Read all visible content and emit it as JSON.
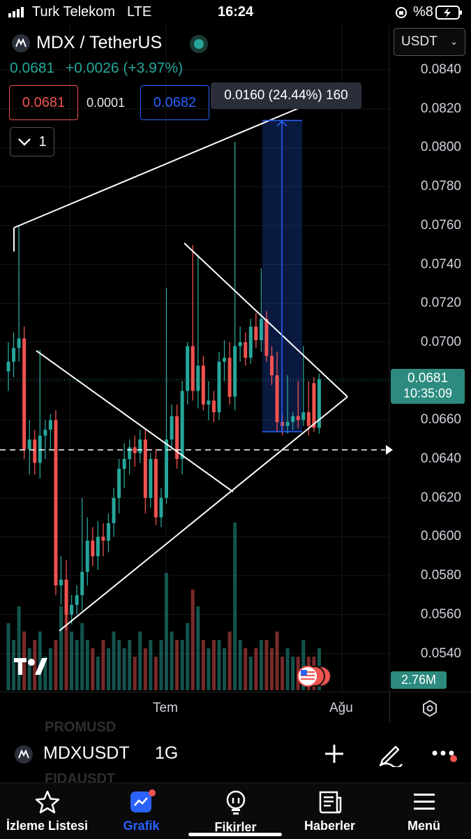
{
  "status_bar": {
    "carrier": "Turk Telekom",
    "network": "LTE",
    "time": "16:24",
    "battery": "%8"
  },
  "header": {
    "symbol_title": "MDX / TetherUS",
    "quote_currency": "USDT",
    "last_price": "0.0681",
    "change": "+0.0026 (+3.97%)",
    "sell_price": "0.0681",
    "spread": "0.0001",
    "buy_price": "0.0682",
    "indicator_count": "1"
  },
  "measure_label": "0.0160 (24.44%) 160",
  "price_axis": [
    "0.0840",
    "0.0820",
    "0.0800",
    "0.0780",
    "0.0760",
    "0.0740",
    "0.0720",
    "0.0700",
    "0.0660",
    "0.0640",
    "0.0620",
    "0.0600",
    "0.0580",
    "0.0560",
    "0.0540"
  ],
  "current_price_tag": {
    "price": "0.0681",
    "countdown": "10:35:09"
  },
  "volume_tag": "2.76M",
  "time_axis": [
    "Tem",
    "Ağu"
  ],
  "symbol_bar": {
    "ticker": "MDXUSDT",
    "interval": "1G",
    "ghost_above": "PROMUSD",
    "ghost_below": "FIDAUSDT"
  },
  "tabs": [
    {
      "label": "İzleme Listesi",
      "icon": "star-icon"
    },
    {
      "label": "Grafik",
      "icon": "chart-icon"
    },
    {
      "label": "Fikirler",
      "icon": "lightbulb-icon"
    },
    {
      "label": "Haberler",
      "icon": "news-icon"
    },
    {
      "label": "Menü",
      "icon": "menu-icon"
    }
  ],
  "colors": {
    "up": "#26a69a",
    "down": "#ef5350",
    "accent": "#2962ff",
    "background": "#000000"
  },
  "chart_data": {
    "type": "candlestick",
    "title": "MDX / TetherUS",
    "ylim": [
      0.0525,
      0.0848
    ],
    "candles": [
      {
        "o": 0.0685,
        "h": 0.07,
        "l": 0.0675,
        "c": 0.069
      },
      {
        "o": 0.069,
        "h": 0.0705,
        "l": 0.0682,
        "c": 0.0697
      },
      {
        "o": 0.0697,
        "h": 0.076,
        "l": 0.069,
        "c": 0.0702
      },
      {
        "o": 0.0702,
        "h": 0.0708,
        "l": 0.064,
        "c": 0.0645
      },
      {
        "o": 0.0645,
        "h": 0.066,
        "l": 0.0632,
        "c": 0.065
      },
      {
        "o": 0.065,
        "h": 0.0655,
        "l": 0.0632,
        "c": 0.0638
      },
      {
        "o": 0.0638,
        "h": 0.0696,
        "l": 0.063,
        "c": 0.0652
      },
      {
        "o": 0.0652,
        "h": 0.066,
        "l": 0.064,
        "c": 0.0655
      },
      {
        "o": 0.0655,
        "h": 0.0663,
        "l": 0.0645,
        "c": 0.066
      },
      {
        "o": 0.066,
        "h": 0.0665,
        "l": 0.057,
        "c": 0.0575
      },
      {
        "o": 0.0575,
        "h": 0.059,
        "l": 0.0565,
        "c": 0.0578
      },
      {
        "o": 0.0578,
        "h": 0.0588,
        "l": 0.0552,
        "c": 0.056
      },
      {
        "o": 0.056,
        "h": 0.057,
        "l": 0.0555,
        "c": 0.0565
      },
      {
        "o": 0.0565,
        "h": 0.0575,
        "l": 0.056,
        "c": 0.057
      },
      {
        "o": 0.057,
        "h": 0.062,
        "l": 0.0562,
        "c": 0.0582
      },
      {
        "o": 0.0582,
        "h": 0.061,
        "l": 0.0575,
        "c": 0.0598
      },
      {
        "o": 0.0598,
        "h": 0.0605,
        "l": 0.0585,
        "c": 0.059
      },
      {
        "o": 0.059,
        "h": 0.0608,
        "l": 0.0583,
        "c": 0.06
      },
      {
        "o": 0.06,
        "h": 0.0607,
        "l": 0.059,
        "c": 0.0598
      },
      {
        "o": 0.0598,
        "h": 0.0612,
        "l": 0.0592,
        "c": 0.0607
      },
      {
        "o": 0.0607,
        "h": 0.0625,
        "l": 0.06,
        "c": 0.062
      },
      {
        "o": 0.062,
        "h": 0.064,
        "l": 0.0612,
        "c": 0.0635
      },
      {
        "o": 0.0635,
        "h": 0.0648,
        "l": 0.0625,
        "c": 0.064
      },
      {
        "o": 0.064,
        "h": 0.065,
        "l": 0.0632,
        "c": 0.0646
      },
      {
        "o": 0.0646,
        "h": 0.0652,
        "l": 0.0636,
        "c": 0.0643
      },
      {
        "o": 0.0643,
        "h": 0.0655,
        "l": 0.0638,
        "c": 0.065
      },
      {
        "o": 0.065,
        "h": 0.0655,
        "l": 0.0612,
        "c": 0.062
      },
      {
        "o": 0.062,
        "h": 0.0643,
        "l": 0.0615,
        "c": 0.064
      },
      {
        "o": 0.064,
        "h": 0.0645,
        "l": 0.0606,
        "c": 0.061
      },
      {
        "o": 0.061,
        "h": 0.0625,
        "l": 0.0605,
        "c": 0.062
      },
      {
        "o": 0.062,
        "h": 0.0728,
        "l": 0.0617,
        "c": 0.065
      },
      {
        "o": 0.065,
        "h": 0.0668,
        "l": 0.0645,
        "c": 0.0662
      },
      {
        "o": 0.0662,
        "h": 0.0668,
        "l": 0.0635,
        "c": 0.064
      },
      {
        "o": 0.064,
        "h": 0.068,
        "l": 0.0632,
        "c": 0.0675
      },
      {
        "o": 0.0675,
        "h": 0.07,
        "l": 0.0668,
        "c": 0.0698
      },
      {
        "o": 0.0698,
        "h": 0.075,
        "l": 0.067,
        "c": 0.0675
      },
      {
        "o": 0.0675,
        "h": 0.0745,
        "l": 0.0666,
        "c": 0.0688
      },
      {
        "o": 0.0688,
        "h": 0.0693,
        "l": 0.0665,
        "c": 0.0668
      },
      {
        "o": 0.0668,
        "h": 0.068,
        "l": 0.066,
        "c": 0.067
      },
      {
        "o": 0.067,
        "h": 0.0675,
        "l": 0.0659,
        "c": 0.0664
      },
      {
        "o": 0.0664,
        "h": 0.0695,
        "l": 0.066,
        "c": 0.069
      },
      {
        "o": 0.069,
        "h": 0.0701,
        "l": 0.068,
        "c": 0.0692
      },
      {
        "o": 0.0692,
        "h": 0.07,
        "l": 0.0668,
        "c": 0.0672
      },
      {
        "o": 0.0672,
        "h": 0.0803,
        "l": 0.0665,
        "c": 0.0698
      },
      {
        "o": 0.0698,
        "h": 0.0708,
        "l": 0.069,
        "c": 0.07
      },
      {
        "o": 0.07,
        "h": 0.0705,
        "l": 0.0688,
        "c": 0.0692
      },
      {
        "o": 0.0692,
        "h": 0.0712,
        "l": 0.0689,
        "c": 0.0708
      },
      {
        "o": 0.0708,
        "h": 0.0715,
        "l": 0.0697,
        "c": 0.0701
      },
      {
        "o": 0.0701,
        "h": 0.0738,
        "l": 0.0695,
        "c": 0.0712
      },
      {
        "o": 0.0712,
        "h": 0.0716,
        "l": 0.069,
        "c": 0.0693
      },
      {
        "o": 0.0693,
        "h": 0.0698,
        "l": 0.0678,
        "c": 0.0683
      },
      {
        "o": 0.0683,
        "h": 0.0695,
        "l": 0.0654,
        "c": 0.0659
      },
      {
        "o": 0.0659,
        "h": 0.0663,
        "l": 0.0652,
        "c": 0.0657
      },
      {
        "o": 0.0657,
        "h": 0.0683,
        "l": 0.0653,
        "c": 0.0659
      },
      {
        "o": 0.0659,
        "h": 0.0664,
        "l": 0.0655,
        "c": 0.0662
      },
      {
        "o": 0.0662,
        "h": 0.068,
        "l": 0.0656,
        "c": 0.066
      },
      {
        "o": 0.066,
        "h": 0.0698,
        "l": 0.0657,
        "c": 0.0664
      },
      {
        "o": 0.0664,
        "h": 0.068,
        "l": 0.0652,
        "c": 0.0657
      },
      {
        "o": 0.0679,
        "h": 0.0682,
        "l": 0.0654,
        "c": 0.0656
      },
      {
        "o": 0.0656,
        "h": 0.0684,
        "l": 0.0653,
        "c": 0.0681
      }
    ],
    "volume": [
      0.4,
      0.3,
      0.5,
      0.35,
      0.25,
      0.3,
      0.35,
      0.2,
      0.25,
      0.3,
      0.5,
      0.6,
      0.35,
      0.3,
      0.4,
      0.3,
      0.25,
      0.2,
      0.3,
      0.25,
      0.35,
      0.3,
      0.25,
      0.3,
      0.2,
      0.35,
      0.25,
      0.3,
      0.2,
      0.3,
      0.7,
      0.35,
      0.3,
      0.3,
      0.4,
      0.6,
      0.5,
      0.3,
      0.25,
      0.3,
      0.3,
      0.25,
      0.35,
      1.0,
      0.3,
      0.25,
      0.2,
      0.25,
      0.3,
      0.3,
      0.25,
      0.35,
      0.2,
      0.25,
      0.2,
      0.2,
      0.3,
      0.2,
      0.2,
      0.25
    ]
  }
}
